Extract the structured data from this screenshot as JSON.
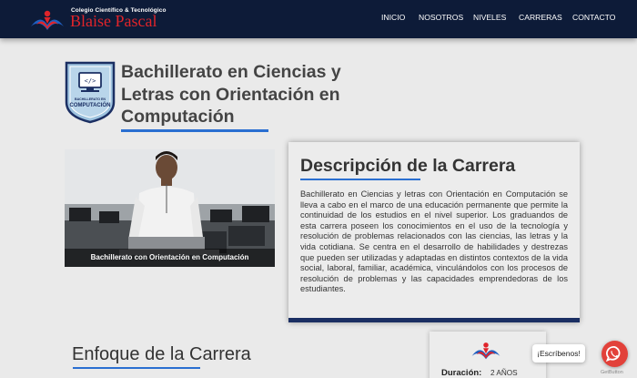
{
  "brand": {
    "subtitle": "Colegio Científico & Tecnológico",
    "name": "Blaise Pascal"
  },
  "nav": {
    "items": [
      {
        "label": "INICIO"
      },
      {
        "label": "NOSOTROS"
      },
      {
        "label": "NIVELES"
      },
      {
        "label": "CARRERAS"
      },
      {
        "label": "CONTACTO"
      }
    ]
  },
  "hero": {
    "badge_text": "BACHILLERATO EN",
    "badge_title": "COMPUTACIÓN",
    "title": "Bachillerato en Ciencias y Letras con Orientación en Computación"
  },
  "photo": {
    "caption": "Bachillerato con Orientación en Computación"
  },
  "description": {
    "title": "Descripción de la Carrera",
    "text": "Bachillerato en Ciencias y letras con Orientación en Computación se lleva a cabo en el marco de una educación permanente que permite la continuidad de los estudios en el nivel superior. Los graduandos de esta carrera poseen los conocimientos en el uso de la tecnología y resolución de problemas relacionados con las ciencias, las letras y la vida cotidiana. Se centra en el desarrollo de habilidades y destrezas que pueden ser utilizadas y adaptadas en distintos contextos de la vida social, laboral, familiar, académica, vinculándolos con los procesos de resolución de problemas y las capacidades emprendedoras de los estudiantes."
  },
  "enfoque": {
    "title": "Enfoque de la Carrera"
  },
  "duration": {
    "label": "Duración:",
    "value": "2 AÑOS"
  },
  "chat": {
    "bubble": "¡Escríbenos!",
    "brand": "GetButton"
  },
  "colors": {
    "navbar": "#0d1b38",
    "brand_red": "#e0242a",
    "accent_blue": "#2a6fd1",
    "card_bottom": "#1b2f63",
    "chat_red": "#e2413a"
  }
}
